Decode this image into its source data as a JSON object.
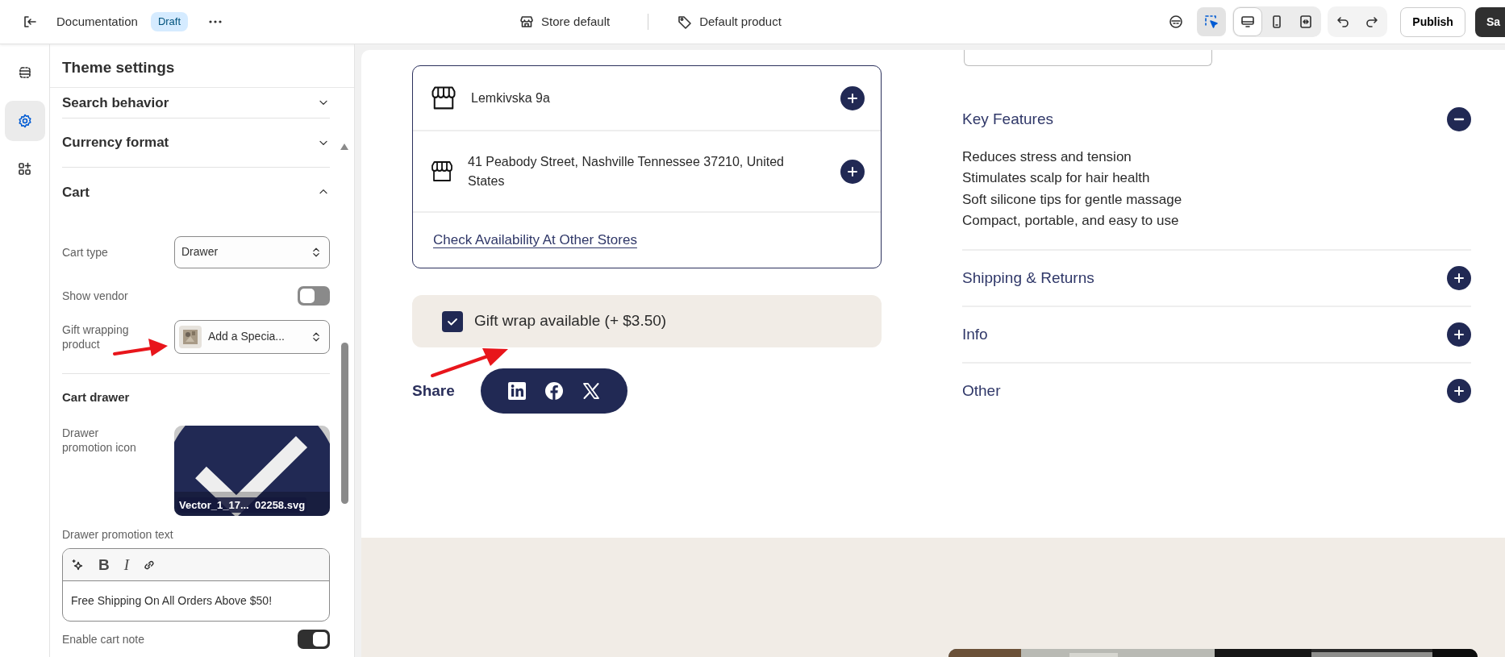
{
  "topbar": {
    "title": "Documentation",
    "status": "Draft",
    "store": "Store default",
    "template": "Default product",
    "tools": [
      {
        "kind": "inspector",
        "selected": false
      },
      {
        "kind": "select",
        "selected": true
      }
    ],
    "views": [
      {
        "kind": "desktop",
        "selected": true
      },
      {
        "kind": "mobile",
        "selected": false
      },
      {
        "kind": "fullwidth",
        "selected": false
      }
    ],
    "publish": "Publish",
    "save": "Sa"
  },
  "rail": [
    {
      "kind": "sections",
      "selected": false
    },
    {
      "kind": "settings",
      "selected": true
    },
    {
      "kind": "apps",
      "selected": false
    }
  ],
  "settings": {
    "title": "Theme settings",
    "sections": [
      {
        "title": "Search behavior",
        "expanded": false
      },
      {
        "title": "Currency format",
        "expanded": false
      },
      {
        "title": "Cart",
        "expanded": true
      }
    ],
    "cart_fields": [
      {
        "kind": "select",
        "label": "Cart type",
        "value": "Drawer"
      },
      {
        "kind": "toggle",
        "label": "Show vendor",
        "on": false
      },
      {
        "kind": "product",
        "label": "Gift wrapping product",
        "value": "Add a Specia..."
      }
    ],
    "subheading": "Cart drawer",
    "drawer_fields": [
      {
        "label": "Drawer promotion icon",
        "filename": "Vector_1_17...  02258.svg"
      },
      {
        "kind": "richtext",
        "label": "Drawer promotion text",
        "format_buttons": [
          "B",
          "I"
        ],
        "value": "Free Shipping On All Orders Above $50!"
      },
      {
        "kind": "toggle",
        "label": "Enable cart note",
        "on": true
      }
    ]
  },
  "preview": {
    "stores": [
      {
        "address": "Lemkivska 9a"
      },
      {
        "address": "41 Peabody Street, Nashville Tennessee 37210, United States"
      }
    ],
    "store_link": "Check Availability At Other Stores",
    "gift_wrap": {
      "label": "Gift wrap available (+ $3.50)",
      "checked": true
    },
    "share": "Share",
    "accordion": [
      {
        "title": "Key Features",
        "expanded": true,
        "items": [
          "Reduces stress and tension",
          "Stimulates scalp for hair health",
          "Soft silicone tips for gentle massage",
          "Compact, portable, and easy to use"
        ]
      },
      {
        "title": "Shipping & Returns",
        "expanded": false
      },
      {
        "title": "Info",
        "expanded": false
      },
      {
        "title": "Other",
        "expanded": false
      }
    ]
  }
}
